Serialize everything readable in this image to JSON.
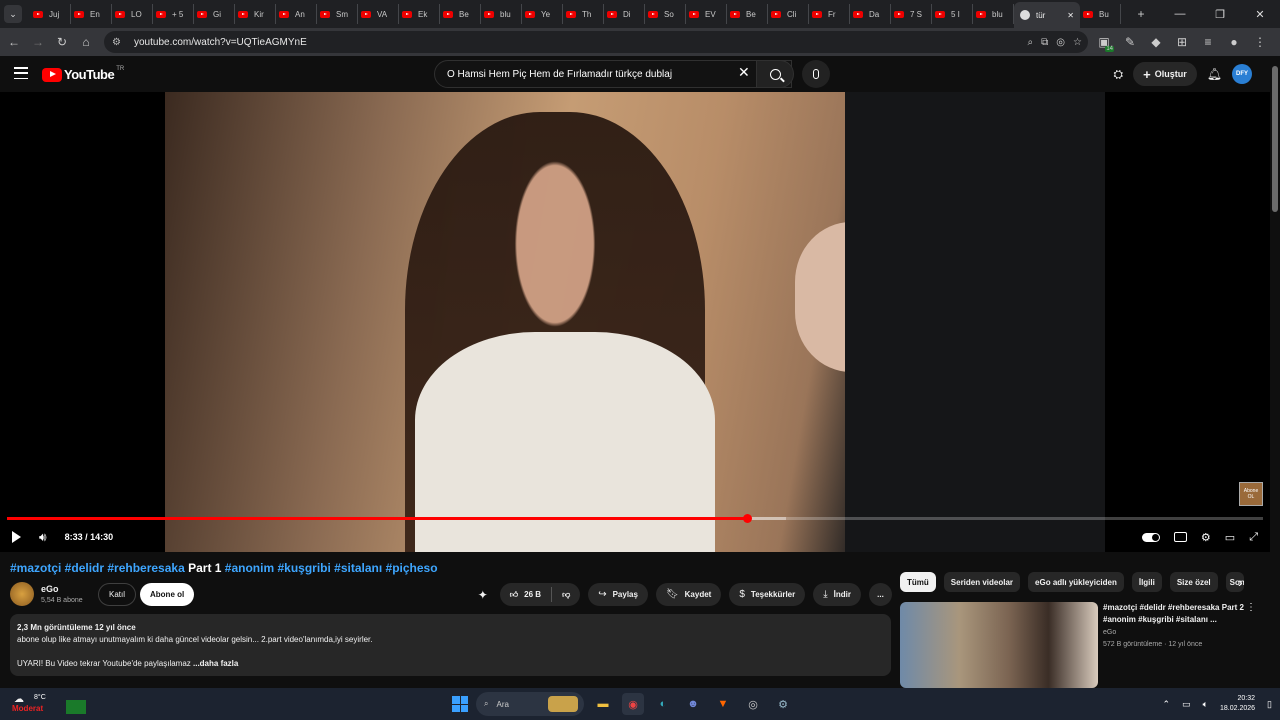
{
  "browser": {
    "tabs": [
      {
        "label": "Juj"
      },
      {
        "label": "En"
      },
      {
        "label": "LO"
      },
      {
        "label": "+ 5"
      },
      {
        "label": "Gi"
      },
      {
        "label": "Kir"
      },
      {
        "label": "An"
      },
      {
        "label": "Sm"
      },
      {
        "label": "VA"
      },
      {
        "label": "Ek"
      },
      {
        "label": "Be"
      },
      {
        "label": "blu"
      },
      {
        "label": "Ye"
      },
      {
        "label": "Th"
      },
      {
        "label": "Di"
      },
      {
        "label": "So"
      },
      {
        "label": "EV"
      },
      {
        "label": "Be"
      },
      {
        "label": "Cli"
      },
      {
        "label": "Fr"
      },
      {
        "label": "Da"
      },
      {
        "label": "7 S"
      },
      {
        "label": "5 I"
      },
      {
        "label": "blu"
      },
      {
        "label": "tür",
        "active": true
      },
      {
        "label": "Bu"
      }
    ],
    "new_tab": "+",
    "url": "youtube.com/watch?v=UQTieAGMYnE",
    "extension_badge": "14"
  },
  "youtube": {
    "logo_text": "YouTube",
    "logo_country": "TR",
    "search_value": "O Hamsi Hem Piç Hem de Fırlamadır türkçe dublaj",
    "create_label": "Oluştur",
    "avatar_text": "DFY"
  },
  "player": {
    "time": "8:33 / 14:30",
    "progress": 0.59,
    "buffered": 0.62,
    "watermark_text": "Abone OL"
  },
  "video": {
    "title_tags_before": "#mazotçi #delidr #rehberesaka",
    "title_plain": " Part 1 ",
    "title_tags_after": "#anonim #kuşgribi #sitalanı #piçheso",
    "channel_name": "eGo",
    "channel_subs": "5,54 B abone",
    "join_label": "Katıl",
    "subscribe_label": "Abone ol",
    "likes": "26 B",
    "share_label": "Paylaş",
    "save_label": "Kaydet",
    "thanks_label": "Teşekkürler",
    "download_label": "İndir",
    "more_label": "...",
    "desc_meta": "2,3 Mn görüntüleme  12 yıl önce",
    "desc_line1": "abone olup like  atmayı unutmayalım ki daha güncel videolar gelsin... 2.part video'lanımda,iyi seyirler.",
    "desc_line2": "UYARI! Bu Video tekrar Youtube'de paylaşılamaz",
    "desc_more": " ...daha fazla"
  },
  "sidebar": {
    "chips": [
      "Tümü",
      "Seriden videolar",
      "eGo adlı yükleyiciden",
      "İlgili",
      "Size özel",
      "Son"
    ],
    "recommendation": {
      "title": "#mazotçi #delidr #rehberesaka Part 2 #anonim #kuşgribi #sitalanı ...",
      "channel": "eGo",
      "meta": "572 B görüntüleme · 12 yıl önce"
    }
  },
  "taskbar": {
    "weather_temp": "8°C",
    "weather_cond": "Moderat",
    "search_label": "Ara",
    "time": "20:32",
    "date": "18.02.2026"
  }
}
